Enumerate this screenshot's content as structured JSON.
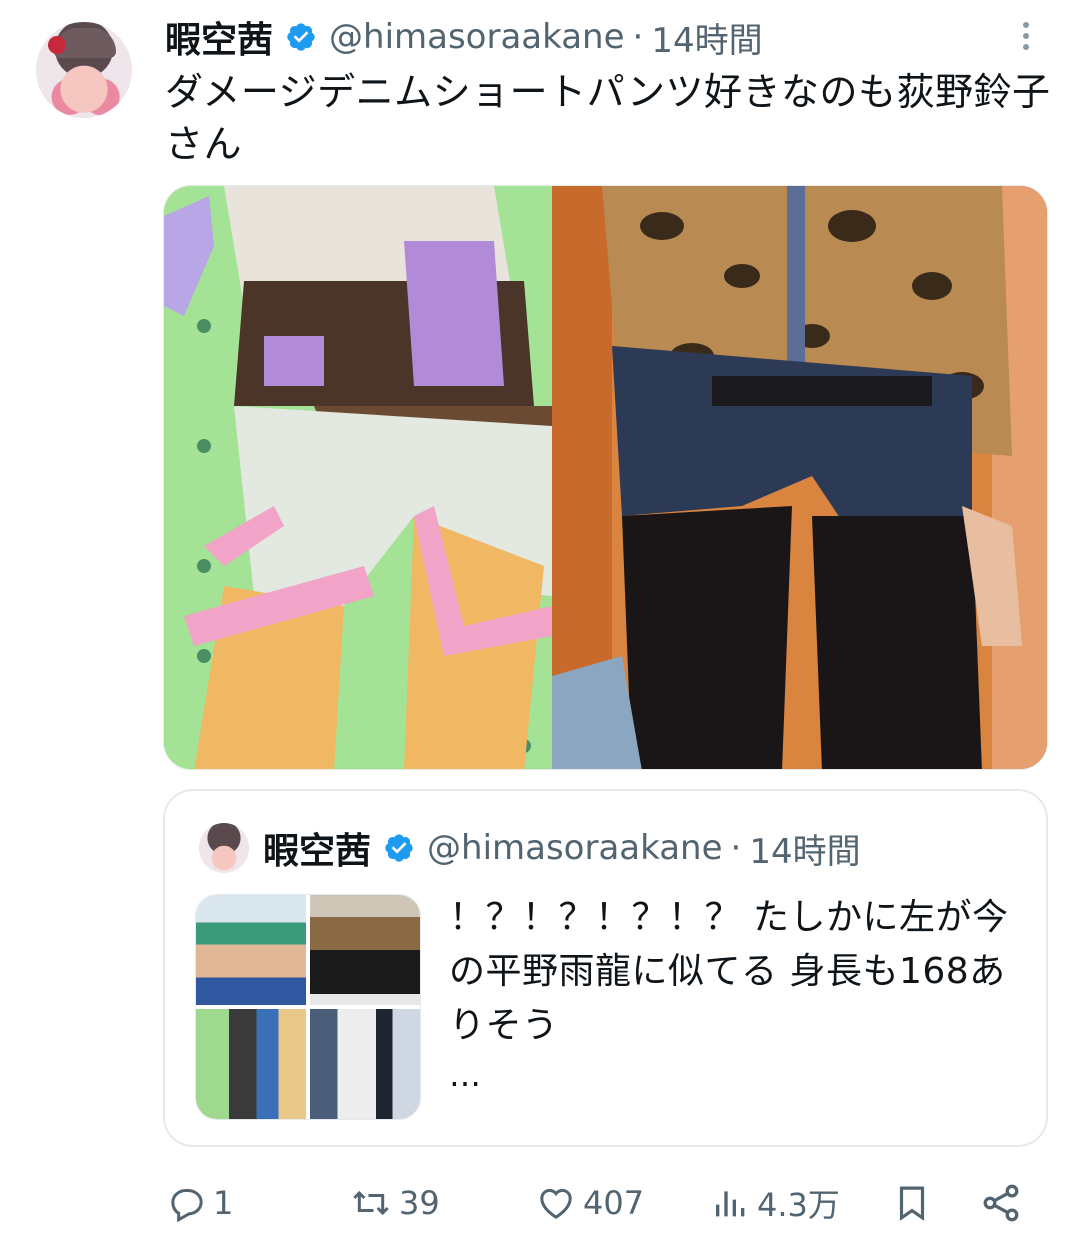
{
  "tweet": {
    "author_name": "暇空茜",
    "handle": "@himasoraakane",
    "separator": "·",
    "time": "14時間",
    "text": "ダメージデニムショートパンツ好きなのも荻野鈴子さん",
    "more_icon": "more-vertical-icon",
    "verified_icon": "verified-badge-icon",
    "verified_color": "#1d9bf0"
  },
  "quote": {
    "author_name": "暇空茜",
    "handle": "@himasoraakane",
    "separator": "·",
    "time": "14時間",
    "text": "！？！？！？！？ たしかに左が今の平野雨龍に似てる 身長も168ありそう",
    "ellipsis": "…"
  },
  "actions": {
    "reply_count": "1",
    "retweet_count": "39",
    "like_count": "407",
    "views_count": "4.3万",
    "icons": [
      "reply-icon",
      "retweet-icon",
      "like-icon",
      "views-icon",
      "bookmark-icon",
      "share-icon"
    ]
  },
  "colors": {
    "text_primary": "#0f1419",
    "text_secondary": "#536471",
    "border": "#e6e9eb"
  }
}
